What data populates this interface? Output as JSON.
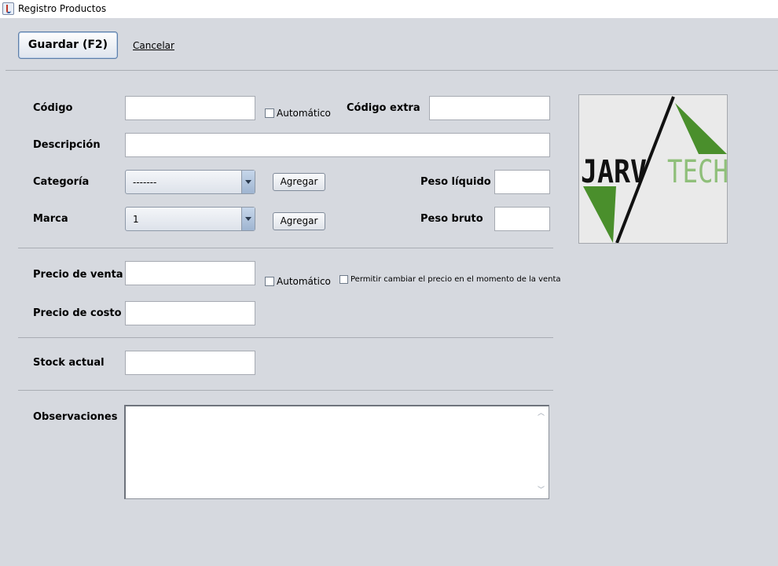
{
  "window": {
    "title": "Registro Productos"
  },
  "toolbar": {
    "save_label": "Guardar (F2)",
    "cancel_label": "Cancelar"
  },
  "form": {
    "codigo": {
      "label": "Código",
      "value": ""
    },
    "codigo_auto": {
      "label": "Automático",
      "checked": false
    },
    "codigo_extra": {
      "label": "Código extra",
      "value": ""
    },
    "descripcion": {
      "label": "Descripción",
      "value": ""
    },
    "categoria": {
      "label": "Categoría",
      "selected": "-------",
      "add_label": "Agregar"
    },
    "marca": {
      "label": "Marca",
      "selected": "1",
      "add_label": "Agregar"
    },
    "peso_liquido": {
      "label": "Peso líquido",
      "value": ""
    },
    "peso_bruto": {
      "label": "Peso bruto",
      "value": ""
    },
    "precio_venta": {
      "label": "Precio de venta",
      "value": ""
    },
    "precio_auto": {
      "label": "Automático",
      "checked": false
    },
    "permitir_cambio": {
      "label": "Permitir cambiar el precio en el momento de la venta",
      "checked": false
    },
    "precio_costo": {
      "label": "Precio de costo",
      "value": ""
    },
    "stock_actual": {
      "label": "Stock actual",
      "value": ""
    },
    "observaciones": {
      "label": "Observaciones",
      "value": ""
    }
  },
  "logo": {
    "text_left": "JARV",
    "text_right": "TECH",
    "dark_color": "#111111",
    "green_color": "#4a8f2c",
    "light_green_color": "#8fbf7a"
  },
  "colors": {
    "background": "#d6d9df",
    "titlebar": "#ffffff"
  }
}
